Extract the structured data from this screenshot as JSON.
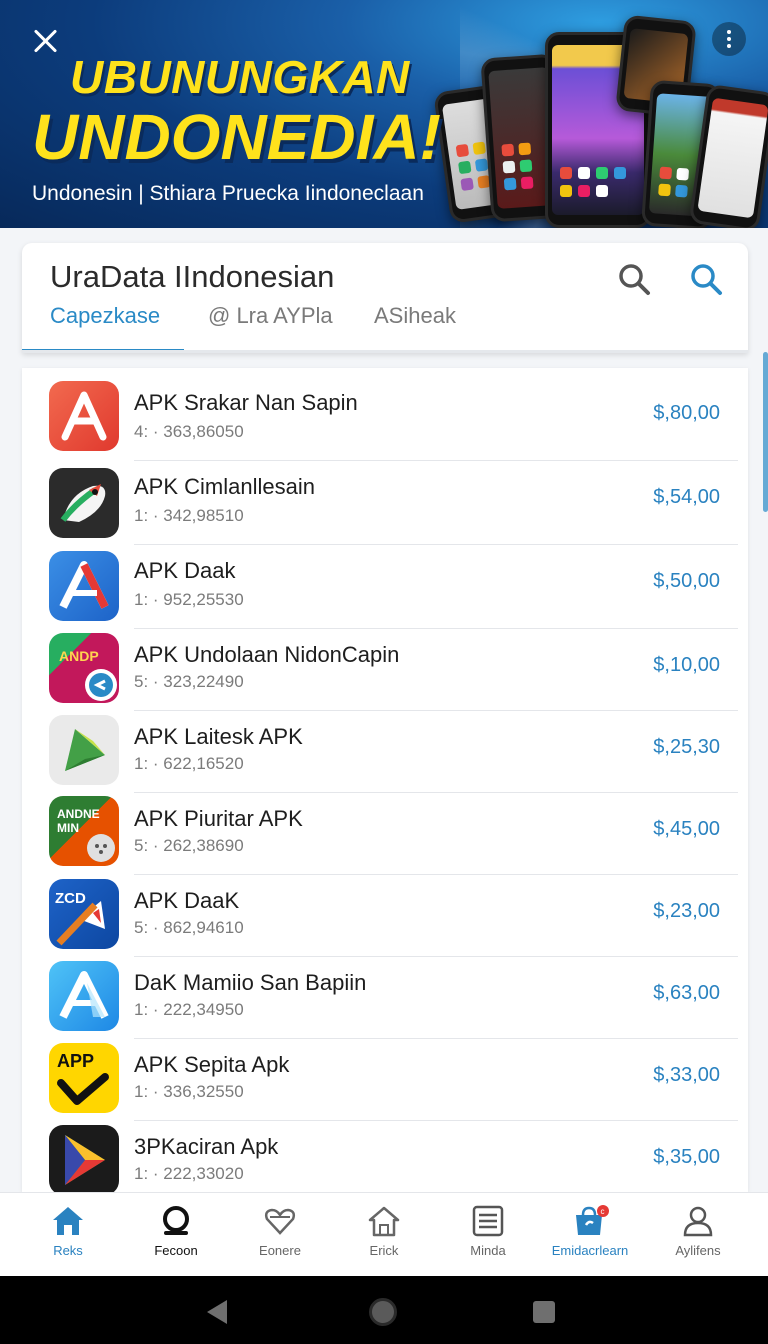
{
  "banner": {
    "title_line1": "UBUNUNGKAN",
    "title_line2": "UNDONEDIA!",
    "subtitle": "Undonesin | Sthiara Pruecka  Iindoneclaan"
  },
  "header": {
    "title": "UraData IIndonesian",
    "tabs": [
      {
        "label": "Capezkase",
        "active": true
      },
      {
        "label": "@ Lra AYPla",
        "active": false
      },
      {
        "label": "ASiheak",
        "active": false
      }
    ]
  },
  "apps": [
    {
      "name": "APK Srakar Nan Sapin",
      "meta": "4: · 363,86050",
      "price": "$,80,00",
      "icon": "letter-a-orange-icon"
    },
    {
      "name": "APK Cimlanllesain",
      "meta": "1: · 342,98510",
      "price": "$,54,00",
      "icon": "bird-icon"
    },
    {
      "name": "APK Daak",
      "meta": "1: · 952,25530",
      "price": "$,50,00",
      "icon": "letter-a-blue-red-icon"
    },
    {
      "name": "APK Undolaan NidonCapin",
      "meta": "5: · 323,22490",
      "price": "$,10,00",
      "icon": "android-chat-icon"
    },
    {
      "name": "APK Laitesk APK",
      "meta": "1: · 622,16520",
      "price": "$,25,30",
      "icon": "green-arrow-icon"
    },
    {
      "name": "APK Piuritar APK",
      "meta": "5: · 262,38690",
      "price": "$,45,00",
      "icon": "android-orange-icon"
    },
    {
      "name": "APK DaaK",
      "meta": "5: · 862,94610",
      "price": "$,23,00",
      "icon": "zcd-blue-icon"
    },
    {
      "name": "DaK Mamiio San Bapiin",
      "meta": "1: · 222,34950",
      "price": "$,63,00",
      "icon": "letter-a-cyan-icon"
    },
    {
      "name": "APK Sepita Apk",
      "meta": "1: · 336,32550",
      "price": "$,33,00",
      "icon": "app-yellow-icon"
    },
    {
      "name": "3PKaciran Apk",
      "meta": "1: · 222,33020",
      "price": "$,35,00",
      "icon": "play-triangle-icon"
    }
  ],
  "nav": [
    {
      "label": "Reks",
      "icon": "home-icon",
      "state": "active"
    },
    {
      "label": "Fecoon",
      "icon": "search-icon",
      "state": "dark"
    },
    {
      "label": "Eonere",
      "icon": "heart-icon",
      "state": "normal"
    },
    {
      "label": "Erick",
      "icon": "house-outline-icon",
      "state": "normal"
    },
    {
      "label": "Minda",
      "icon": "list-icon",
      "state": "normal"
    },
    {
      "label": "Emidacrlearn",
      "icon": "shopping-bag-icon",
      "state": "active",
      "badge": "c"
    },
    {
      "label": "Aylifens",
      "icon": "person-icon",
      "state": "normal"
    }
  ],
  "colors": {
    "accent": "#2a8ac6",
    "price": "#2a82c0",
    "banner_title": "#ffe21c",
    "banner_bg": "#0c3c7c"
  }
}
